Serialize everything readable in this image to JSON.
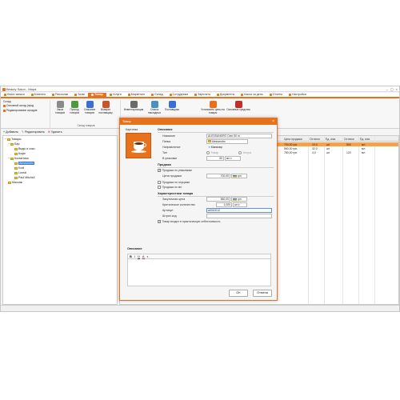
{
  "app": {
    "title": "Beauty Salon - Мира"
  },
  "window_buttons": [
    "–",
    "▢",
    "×"
  ],
  "menu": [
    {
      "label": "Книга записи",
      "active": false
    },
    {
      "label": "Клиенты",
      "active": false
    },
    {
      "label": "Рассылки",
      "active": false
    },
    {
      "label": "Залы",
      "active": false
    },
    {
      "label": "Товар",
      "active": true
    },
    {
      "label": "Услуги",
      "active": false
    },
    {
      "label": "Маркетинг",
      "active": false
    },
    {
      "label": "Склад",
      "active": false
    },
    {
      "label": "Сотрудники",
      "active": false
    },
    {
      "label": "Зарплата",
      "active": false
    },
    {
      "label": "Документы",
      "active": false
    },
    {
      "label": "Касса за день",
      "active": false
    },
    {
      "label": "Отчеты",
      "active": false
    },
    {
      "label": "Настройки",
      "active": false
    }
  ],
  "ribbon": {
    "warehouse_group": "Склад",
    "warehouse_field": "Основной склад (прод",
    "edit_warehouse": "Редактирование складов",
    "goods_group": "Склад товаров",
    "buttons": [
      "Заказ товаров",
      "Приход товаров",
      "Списание товаров",
      "Возврат поставщику",
      "Инвентаризация",
      "Список накладных",
      "Поставщики",
      "Установить цены на товары",
      "Основные средства"
    ]
  },
  "toolbar": {
    "add": "Добавить",
    "edit": "Редактировать",
    "delete": "Удалить"
  },
  "tree": {
    "root": "Товары",
    "nodes": [
      "Бар",
      "Виды и соки",
      "Кофе",
      "Косметика",
      "Alessandro",
      "Kodi",
      "Loreal",
      "Paul Mitchell",
      "Массаж"
    ]
  },
  "grid": {
    "headers": [
      "Цена продажи",
      "Остатки",
      "Ед. изм.",
      "Остатки",
      "Ед. изм."
    ],
    "rows": [
      {
        "price": "700,00 грн.",
        "rest": "10,0",
        "unit": "шт",
        "rest2": "500",
        "unit2": "мл"
      },
      {
        "price": "560,00 грн.",
        "rest": "32,0",
        "unit": "шт",
        "rest2": "",
        "unit2": "мл"
      },
      {
        "price": "780,00 грн.",
        "rest": "4,0",
        "unit": "шт",
        "rest2": "120",
        "unit2": "мл"
      }
    ]
  },
  "dialog": {
    "title": "Товар",
    "close": "×",
    "picture_label": "Картинка",
    "desc_section": "Описание",
    "name_label": "Название",
    "name_value": "ALESSANDRO Cem 50 m",
    "folder_label": "Папка",
    "folder_value": "Alessandro",
    "direction_label": "Направление",
    "direction_value": "Маникюр",
    "type_label": "Тип",
    "type_opt1": "Товар",
    "type_opt2": "Услуга",
    "pack_label": "В упаковке",
    "pack_value": "50",
    "pack_unit": "мл",
    "sale_section": "Продажа",
    "sale_by_pack": "Продажа по упаковкам",
    "sale_price_label": "Цена продажи",
    "sale_price_value": "700,00",
    "currency": "грн",
    "sale_by_portion": "Продажа по порциям",
    "sale_by_ml": "Продажа по мл",
    "chars_section": "Характеристики товара",
    "purchase_label": "Закупочная цена",
    "purchase_value": "560,00",
    "critical_label": "Критическое количество",
    "critical_value": "1,000",
    "critical_unit": "шт",
    "article_label": "Артикул",
    "article_value": "a0010012",
    "barcode_label": "Штрих-код",
    "barcode_value": "",
    "cost_check": "Товар входит в практическую себестоимость",
    "desc_label": "Описание",
    "editor_bold": "B",
    "editor_italic": "I",
    "editor_underline": "U",
    "editor_color": "A",
    "ok": "OK",
    "cancel": "Отмена"
  }
}
